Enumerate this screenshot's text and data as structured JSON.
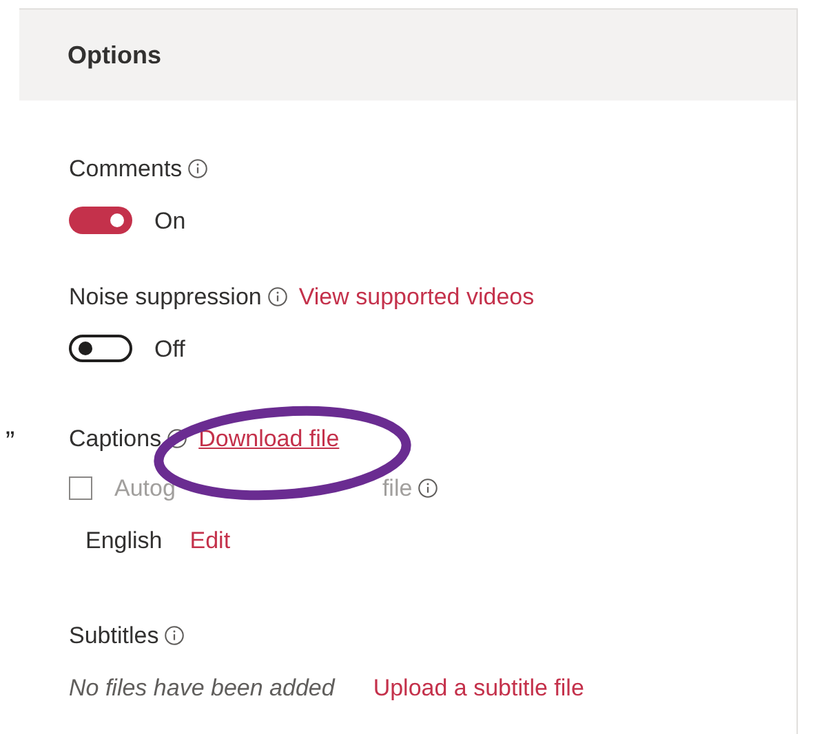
{
  "stray_mark": "”",
  "panel": {
    "title": "Options"
  },
  "comments": {
    "label": "Comments",
    "toggle": {
      "on": true,
      "label": "On"
    }
  },
  "noise_suppression": {
    "label": "Noise suppression",
    "link": "View supported videos",
    "toggle": {
      "on": false,
      "label": "Off"
    }
  },
  "captions": {
    "label": "Captions",
    "link": "Download file",
    "autogenerate": {
      "label_start": "Autog",
      "label_end": "file",
      "checked": false
    },
    "language": "English",
    "edit_link": "Edit"
  },
  "subtitles": {
    "label": "Subtitles",
    "empty_note": "No files have been added",
    "upload_link": "Upload a subtitle file"
  }
}
